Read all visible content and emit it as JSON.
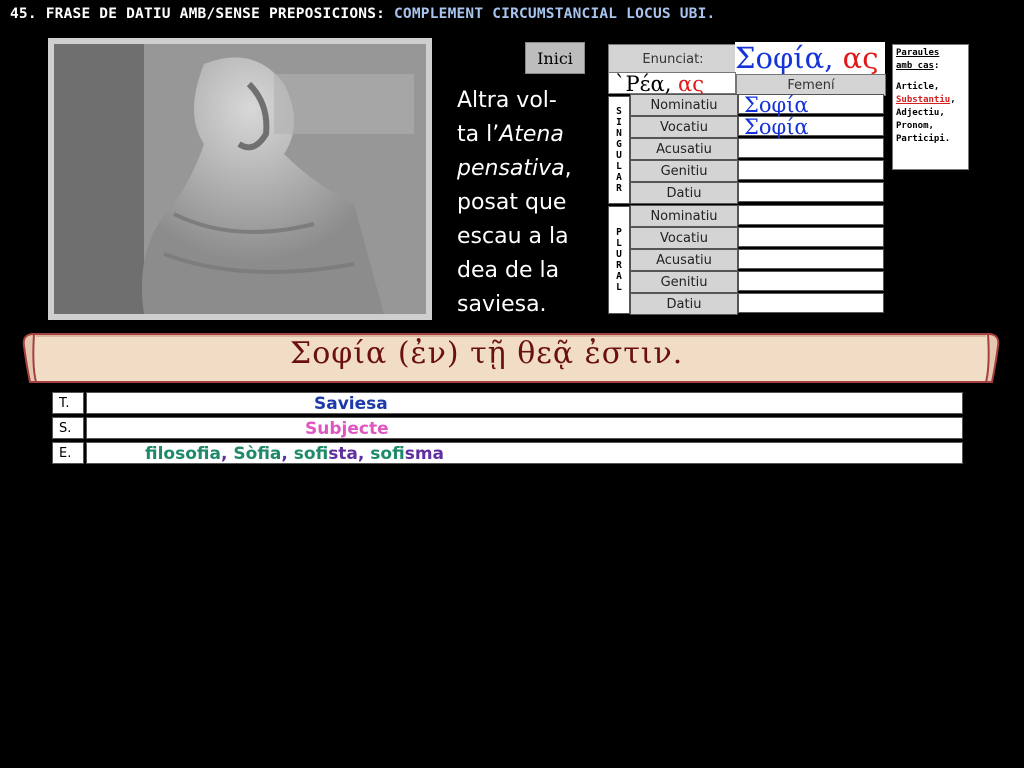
{
  "header": {
    "title_main": "45. FRASE DE DATIU AMB/SENSE PREPOSICIONS: ",
    "title_accent": "COMPLEMENT CIRCUMSTANCIAL LOCUS UBI."
  },
  "nav": {
    "inici_label": "Inici"
  },
  "caption": {
    "line1": "Altra vol-",
    "line2_pre": "ta l’",
    "line2_it": "Atena",
    "line3_it": "pensativa",
    "line3_post": ",",
    "line4": "posat que",
    "line5": "escau a la",
    "line6": "dea de la",
    "line7": "saviesa."
  },
  "declension": {
    "enunciat_label": "Enunciat:",
    "enunciat_stem": "Σοφία, ",
    "enunciat_ending": "ας",
    "model_stem": "`Ρέα, ",
    "model_ending": "ας",
    "gender_label": "Femení",
    "singular_label": [
      "S",
      "I",
      "N",
      "G",
      "U",
      "L",
      "A",
      "R"
    ],
    "plural_label": [
      "P",
      "L",
      "U",
      "R",
      "A",
      "L"
    ],
    "singular": [
      {
        "case": "Nominatiu",
        "form": "Σοφία"
      },
      {
        "case": "Vocatiu",
        "form": "Σοφία"
      },
      {
        "case": "Acusatiu",
        "form": ""
      },
      {
        "case": "Genitiu",
        "form": ""
      },
      {
        "case": "Datiu",
        "form": ""
      }
    ],
    "plural": [
      {
        "case": "Nominatiu",
        "form": ""
      },
      {
        "case": "Vocatiu",
        "form": ""
      },
      {
        "case": "Acusatiu",
        "form": ""
      },
      {
        "case": "Genitiu",
        "form": ""
      },
      {
        "case": "Datiu",
        "form": ""
      }
    ]
  },
  "paraules": {
    "head1": "Paraules",
    "head2": "amb cas",
    "head_colon": ":",
    "items": [
      "Article,",
      "Substantiu",
      "Adjectiu,",
      "Pronom,",
      "Participi."
    ],
    "items_comma": ","
  },
  "sentence": {
    "greek": "Σοφία   (ἐν)   τῇ   θεᾷ   ἐστιν."
  },
  "vocab": {
    "t_key": "T.",
    "t_value": "Saviesa",
    "s_key": "S.",
    "s_value": "Subjecte",
    "e_key": "E.",
    "e_parts": [
      "filo",
      "sofia",
      ", ",
      "Sò",
      "fia",
      ", ",
      "sofi",
      "sta",
      ", ",
      "sofi",
      "sma"
    ]
  },
  "colors": {
    "greek_blue": "#1533d8",
    "ending_red": "#e01818",
    "title_accent": "#a8c4ee",
    "scroll_text": "#6b1010"
  }
}
